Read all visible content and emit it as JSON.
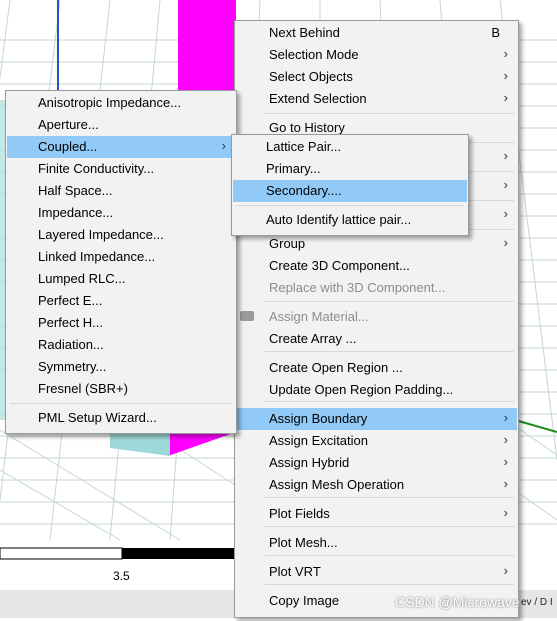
{
  "colors": {
    "menu_bg": "#f2f2f2",
    "highlight": "#91c9f7",
    "box_magenta": "#ff00ff",
    "grid": "#c7d5d5"
  },
  "scale_bar": {
    "label": "3.5"
  },
  "status": {
    "text": "ev / D I"
  },
  "watermark": {
    "text": "CSDN @Microwave"
  },
  "main_menu": {
    "items": [
      {
        "label": "Next Behind",
        "shortcut": "B"
      },
      {
        "label": "Selection Mode",
        "arrow": true
      },
      {
        "label": "Select Objects",
        "arrow": true
      },
      {
        "label": "Extend Selection",
        "arrow": true
      },
      {
        "label": "Go to History"
      },
      {
        "label": "",
        "arrow": true
      },
      {
        "label": "",
        "arrow": true
      },
      {
        "label": "",
        "arrow": true
      },
      {
        "label": "Group",
        "arrow": true
      },
      {
        "label": "Create 3D Component..."
      },
      {
        "label": "Replace with 3D Component...",
        "disabled": true
      },
      {
        "label": "Assign Material...",
        "disabled": true,
        "icon": "material-icon"
      },
      {
        "label": "Create Array ..."
      },
      {
        "label": "Create Open Region ..."
      },
      {
        "label": "Update Open Region Padding..."
      },
      {
        "label": "Assign Boundary",
        "arrow": true,
        "highlighted": true
      },
      {
        "label": "Assign Excitation",
        "arrow": true
      },
      {
        "label": "Assign Hybrid",
        "arrow": true
      },
      {
        "label": "Assign Mesh Operation",
        "arrow": true
      },
      {
        "label": "Plot Fields",
        "arrow": true
      },
      {
        "label": "Plot Mesh..."
      },
      {
        "label": "Plot VRT",
        "arrow": true
      },
      {
        "label": "Copy Image"
      }
    ]
  },
  "boundary_menu": {
    "items": [
      {
        "label": "Anisotropic Impedance..."
      },
      {
        "label": "Aperture..."
      },
      {
        "label": "Coupled...",
        "arrow": true,
        "highlighted": true
      },
      {
        "label": "Finite Conductivity..."
      },
      {
        "label": "Half Space..."
      },
      {
        "label": "Impedance..."
      },
      {
        "label": "Layered Impedance..."
      },
      {
        "label": "Linked Impedance..."
      },
      {
        "label": "Lumped RLC..."
      },
      {
        "label": "Perfect E..."
      },
      {
        "label": "Perfect H..."
      },
      {
        "label": "Radiation..."
      },
      {
        "label": "Symmetry..."
      },
      {
        "label": "Fresnel (SBR+)"
      },
      {
        "label": "PML Setup Wizard..."
      }
    ]
  },
  "coupled_menu": {
    "items": [
      {
        "label": "Lattice Pair..."
      },
      {
        "label": "Primary..."
      },
      {
        "label": "Secondary....",
        "highlighted": true
      },
      {
        "label": "Auto Identify lattice pair..."
      }
    ]
  }
}
